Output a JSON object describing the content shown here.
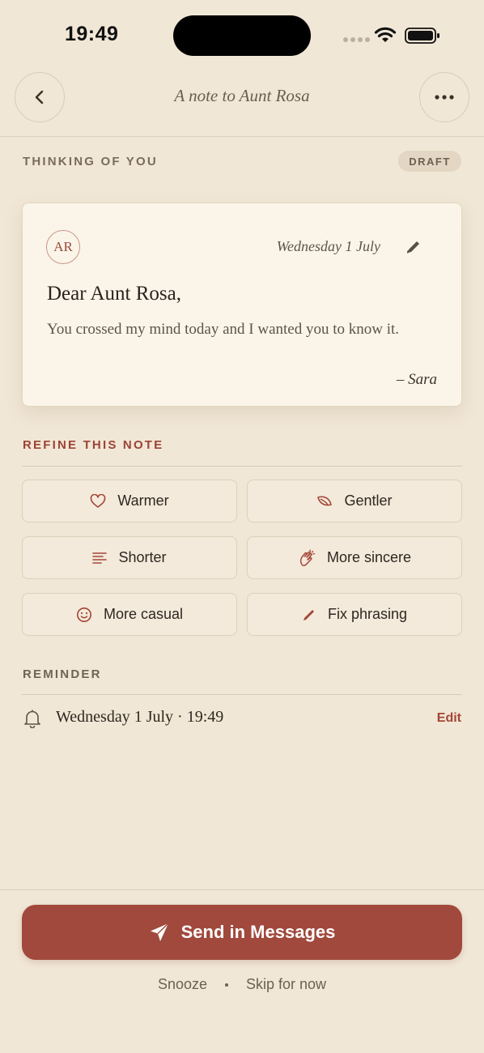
{
  "status_bar": {
    "time": "19:49"
  },
  "nav": {
    "title": "A note to Aunt Rosa"
  },
  "header": {
    "section_label": "THINKING OF YOU",
    "badge": "DRAFT"
  },
  "note": {
    "initials": "AR",
    "date": "Wednesday 1 July",
    "salutation": "Dear Aunt Rosa,",
    "body": "You crossed my mind today and I wanted you to know it.",
    "signature": "– Sara"
  },
  "refine": {
    "label": "REFINE THIS NOTE",
    "options": [
      {
        "label": "Warmer",
        "icon": "heart-icon"
      },
      {
        "label": "Gentler",
        "icon": "leaf-icon"
      },
      {
        "label": "Shorter",
        "icon": "lines-icon"
      },
      {
        "label": "More sincere",
        "icon": "clapping-hands-icon"
      },
      {
        "label": "More casual",
        "icon": "smiley-icon"
      },
      {
        "label": "Fix phrasing",
        "icon": "pencil-icon"
      }
    ]
  },
  "reminder": {
    "label": "REMINDER",
    "text": "Wednesday 1 July · 19:49",
    "edit_label": "Edit"
  },
  "actions": {
    "send_label": "Send in Messages",
    "snooze_label": "Snooze",
    "skip_label": "Skip for now"
  },
  "colors": {
    "background": "#f1e7d6",
    "accent": "#a0493c",
    "card": "#fbf5e9"
  }
}
